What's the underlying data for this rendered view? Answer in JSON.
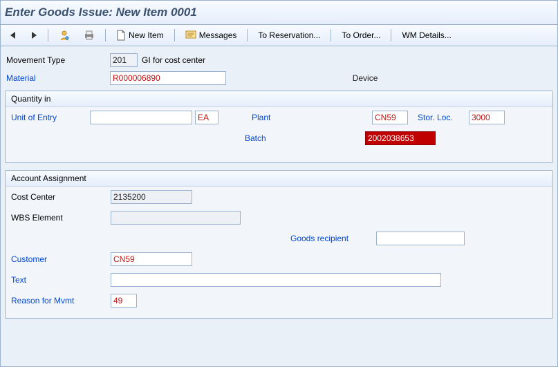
{
  "title": "Enter Goods Issue: New Item 0001",
  "toolbar": {
    "new_item_label": "New Item",
    "messages_label": "Messages",
    "to_reservation_label": "To Reservation...",
    "to_order_label": "To Order...",
    "wm_details_label": "WM Details..."
  },
  "header": {
    "movement_type_label": "Movement Type",
    "movement_type_value": "201",
    "movement_type_text": "GI for cost center",
    "material_label": "Material",
    "material_value": "R000006890",
    "material_desc_partial": "Device"
  },
  "quantity": {
    "group_title": "Quantity in",
    "unit_of_entry_label": "Unit of Entry",
    "unit_of_entry_value": "",
    "unit_of_entry_uom": "EA",
    "plant_label": "Plant",
    "plant_value": "CN59",
    "stor_loc_label": "Stor. Loc.",
    "stor_loc_value": "3000",
    "batch_label": "Batch",
    "batch_value": "2002038653"
  },
  "account": {
    "group_title": "Account Assignment",
    "cost_center_label": "Cost Center",
    "cost_center_value": "2135200",
    "wbs_label": "WBS Element",
    "wbs_value": "",
    "goods_recipient_label": "Goods recipient",
    "goods_recipient_value": "",
    "customer_label": "Customer",
    "customer_value": "CN59",
    "text_label": "Text",
    "text_value": "",
    "reason_label": "Reason for Mvmt",
    "reason_value": "49"
  }
}
